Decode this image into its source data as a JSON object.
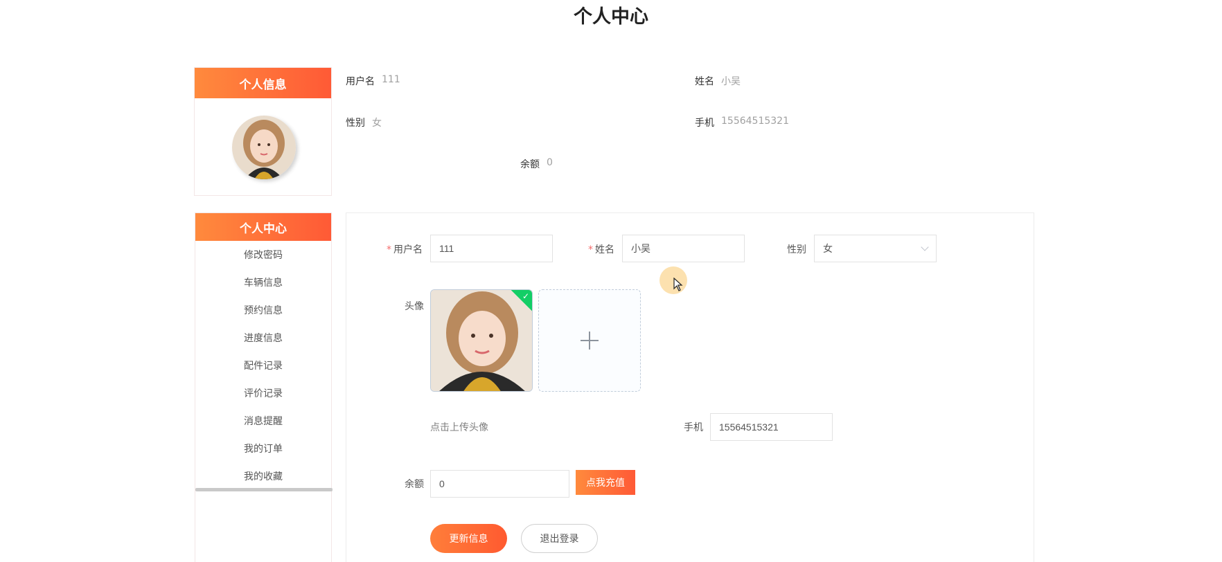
{
  "page": {
    "title": "个人中心"
  },
  "profile_card": {
    "header": "个人信息"
  },
  "summary": {
    "username_label": "用户名",
    "username_value": "111",
    "name_label": "姓名",
    "name_value": "小吴",
    "gender_label": "性别",
    "gender_value": "女",
    "phone_label": "手机",
    "phone_value": "15564515321",
    "balance_label": "余额",
    "balance_value": "0"
  },
  "menu": {
    "header": "个人中心",
    "items": [
      {
        "label": "修改密码"
      },
      {
        "label": "车辆信息"
      },
      {
        "label": "预约信息"
      },
      {
        "label": "进度信息"
      },
      {
        "label": "配件记录"
      },
      {
        "label": "评价记录"
      },
      {
        "label": "消息提醒"
      },
      {
        "label": "我的订单"
      },
      {
        "label": "我的收藏"
      }
    ]
  },
  "form": {
    "username": {
      "label": "用户名",
      "value": "111",
      "required": "*"
    },
    "name": {
      "label": "姓名",
      "value": "小吴",
      "required": "*"
    },
    "gender": {
      "label": "性别",
      "value": "女"
    },
    "avatar": {
      "label": "头像",
      "hint": "点击上传头像"
    },
    "phone": {
      "label": "手机",
      "value": "15564515321"
    },
    "balance": {
      "label": "余额",
      "value": "0"
    },
    "recharge_button": "点我充值",
    "update_button": "更新信息",
    "logout_button": "退出登录"
  },
  "colors": {
    "accent": "#ff6a35",
    "success": "#13ce66",
    "required": "#f56c6c"
  },
  "icons": {
    "upload": "plus-icon",
    "uploaded": "check-icon",
    "select": "chevron-down-icon",
    "cursor": "cursor-icon"
  }
}
